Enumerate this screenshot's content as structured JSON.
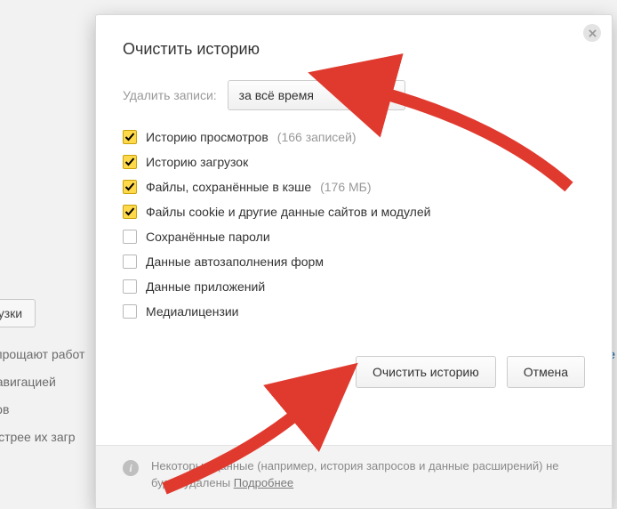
{
  "background": {
    "button_zagruzki": "грузки",
    "text_uproshayut": "упрощают работ",
    "text_navigatsiei": "навигацией",
    "text_cov": "сов",
    "text_bystree": "ыстрее их загр",
    "link_ee": "ее"
  },
  "dialog": {
    "title": "Очистить историю",
    "delete_label": "Удалить записи:",
    "range_selected": "за всё время",
    "options": [
      {
        "key": "browsing",
        "label": "Историю просмотров",
        "count": "(166 записей)",
        "checked": true
      },
      {
        "key": "downloads",
        "label": "Историю загрузок",
        "count": "",
        "checked": true
      },
      {
        "key": "cache",
        "label": "Файлы, сохранённые в кэше",
        "count": "(176 МБ)",
        "checked": true
      },
      {
        "key": "cookies",
        "label": "Файлы cookie и другие данные сайтов и модулей",
        "count": "",
        "checked": true
      },
      {
        "key": "passwords",
        "label": "Сохранённые пароли",
        "count": "",
        "checked": false
      },
      {
        "key": "autofill",
        "label": "Данные автозаполнения форм",
        "count": "",
        "checked": false
      },
      {
        "key": "appdata",
        "label": "Данные приложений",
        "count": "",
        "checked": false
      },
      {
        "key": "media",
        "label": "Медиалицензии",
        "count": "",
        "checked": false
      }
    ],
    "btn_clear": "Очистить историю",
    "btn_cancel": "Отмена",
    "footer_text": "Некоторые данные (например, история запросов и данные расширений) не будут удалены ",
    "footer_link": "Подробнее"
  }
}
